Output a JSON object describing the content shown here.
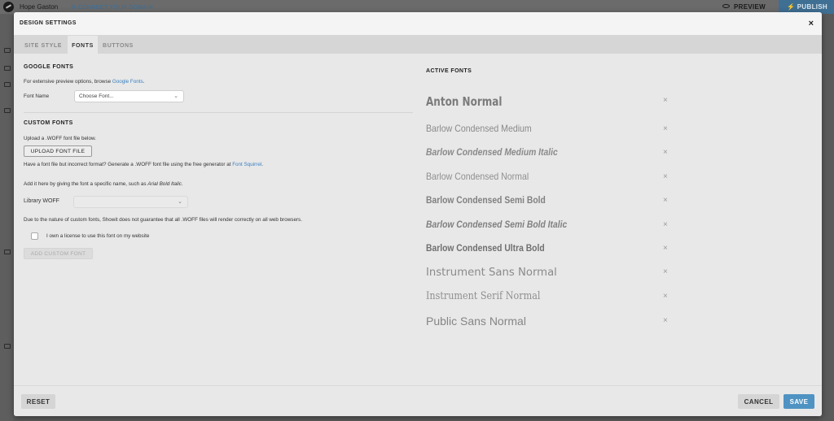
{
  "app": {
    "site_name": "Hope Gaston",
    "connect_domain": "CONNECT YOUR DOMAIN",
    "preview": "PREVIEW",
    "publish": "PUBLISH"
  },
  "modal": {
    "title": "DESIGN SETTINGS",
    "close": "×"
  },
  "tabs": [
    {
      "label": "SITE STYLE",
      "active": false
    },
    {
      "label": "FONTS",
      "active": true
    },
    {
      "label": "BUTTONS",
      "active": false
    }
  ],
  "google_fonts": {
    "heading": "GOOGLE FONTS",
    "intro_prefix": "For extensive preview options, browse ",
    "intro_link": "Google Fonts",
    "intro_suffix": ".",
    "font_name_label": "Font Name",
    "font_select_value": "Choose Font..."
  },
  "custom_fonts": {
    "heading": "CUSTOM FONTS",
    "upload_prompt": "Upload a .WOFF font file below.",
    "upload_button": "UPLOAD FONT FILE",
    "incorrect_format_prefix": "Have a font file but incorrect format? Generate a .WOFF font file using the free generator at ",
    "incorrect_format_link": "Font Squirrel",
    "incorrect_format_suffix": ".",
    "add_hint_prefix": "Add it here by giving the font a specific name, such as ",
    "add_hint_example": "Arial Bold Italic",
    "add_hint_suffix": ".",
    "library_label": "Library WOFF",
    "library_value": "",
    "disclaimer": "Due to the nature of custom fonts, Showit does not guarantee that all .WOFF files will render correctly on all web browsers.",
    "license_label": "I own a license to use this font on my website",
    "license_checked": false,
    "add_button": "ADD CUSTOM FONT"
  },
  "active_fonts": {
    "heading": "ACTIVE FONTS",
    "remove_symbol": "×",
    "items": [
      {
        "name": "Anton Normal"
      },
      {
        "name": "Barlow Condensed Medium"
      },
      {
        "name": "Barlow Condensed Medium Italic"
      },
      {
        "name": "Barlow Condensed Normal"
      },
      {
        "name": "Barlow Condensed Semi Bold"
      },
      {
        "name": "Barlow Condensed Semi Bold Italic"
      },
      {
        "name": "Barlow Condensed Ultra Bold"
      },
      {
        "name": "Instrument Sans Normal"
      },
      {
        "name": "Instrument Serif Normal"
      },
      {
        "name": "Public Sans Normal"
      }
    ]
  },
  "footer": {
    "reset": "RESET",
    "cancel": "CANCEL",
    "save": "SAVE"
  },
  "colors": {
    "accent": "#4f93c3",
    "link": "#3a7fc0",
    "publish": "#3f6f93"
  }
}
